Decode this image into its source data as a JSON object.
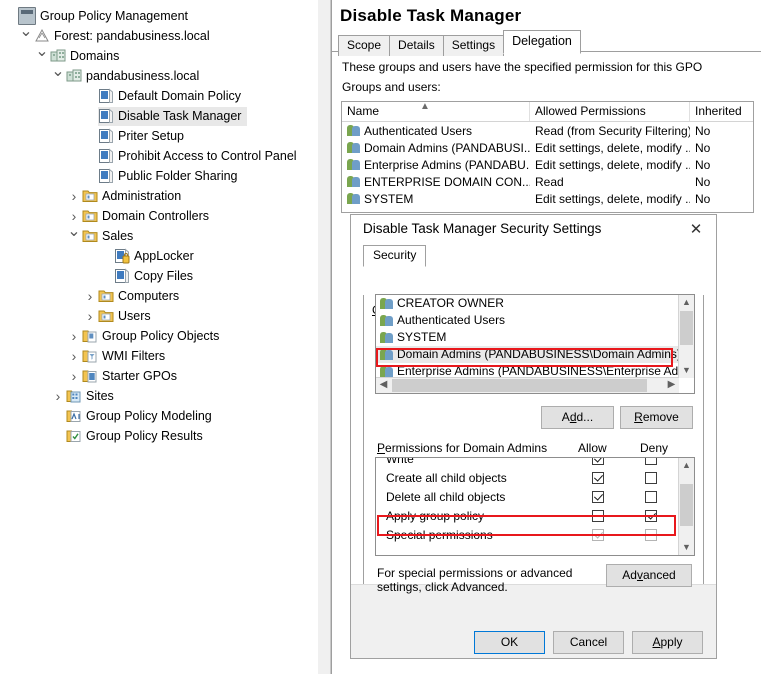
{
  "tree": {
    "items": [
      {
        "label": "Group Policy Management",
        "indent": 0,
        "chev": "",
        "icon": "console-icon",
        "selected": false
      },
      {
        "label": "Forest: pandabusiness.local",
        "indent": 1,
        "chev": "v",
        "icon": "forest-icon",
        "selected": false
      },
      {
        "label": "Domains",
        "indent": 2,
        "chev": "v",
        "icon": "domains-icon",
        "selected": false
      },
      {
        "label": "pandabusiness.local",
        "indent": 3,
        "chev": "v",
        "icon": "domain-icon",
        "selected": false
      },
      {
        "label": "Default Domain Policy",
        "indent": 5,
        "chev": "",
        "icon": "gpo-icon",
        "selected": false
      },
      {
        "label": "Disable Task Manager",
        "indent": 5,
        "chev": "",
        "icon": "gpo-icon",
        "selected": true
      },
      {
        "label": "Priter Setup",
        "indent": 5,
        "chev": "",
        "icon": "gpo-icon",
        "selected": false
      },
      {
        "label": "Prohibit Access to Control Panel",
        "indent": 5,
        "chev": "",
        "icon": "gpo-icon",
        "selected": false
      },
      {
        "label": "Public Folder Sharing",
        "indent": 5,
        "chev": "",
        "icon": "gpo-icon",
        "selected": false
      },
      {
        "label": "Administration",
        "indent": 4,
        "chev": ">",
        "icon": "ou-folder-icon",
        "selected": false
      },
      {
        "label": "Domain Controllers",
        "indent": 4,
        "chev": ">",
        "icon": "ou-folder-icon",
        "selected": false
      },
      {
        "label": "Sales",
        "indent": 4,
        "chev": "v",
        "icon": "ou-folder-icon",
        "selected": false
      },
      {
        "label": "AppLocker",
        "indent": 6,
        "chev": "",
        "icon": "gpo-locked-icon",
        "selected": false
      },
      {
        "label": "Copy Files",
        "indent": 6,
        "chev": "",
        "icon": "gpo-icon",
        "selected": false
      },
      {
        "label": "Computers",
        "indent": 5,
        "chev": ">",
        "icon": "ou-folder-icon",
        "selected": false
      },
      {
        "label": "Users",
        "indent": 5,
        "chev": ">",
        "icon": "ou-folder-icon",
        "selected": false
      },
      {
        "label": "Group Policy Objects",
        "indent": 4,
        "chev": ">",
        "icon": "gpo-container-icon",
        "selected": false
      },
      {
        "label": "WMI Filters",
        "indent": 4,
        "chev": ">",
        "icon": "wmi-filter-icon",
        "selected": false
      },
      {
        "label": "Starter GPOs",
        "indent": 4,
        "chev": ">",
        "icon": "starter-gpo-icon",
        "selected": false
      },
      {
        "label": "Sites",
        "indent": 3,
        "chev": ">",
        "icon": "sites-icon",
        "selected": false
      },
      {
        "label": "Group Policy Modeling",
        "indent": 3,
        "chev": "",
        "icon": "modeling-icon",
        "selected": false
      },
      {
        "label": "Group Policy Results",
        "indent": 3,
        "chev": "",
        "icon": "results-icon",
        "selected": false
      }
    ]
  },
  "right_pane": {
    "title": "Disable Task Manager",
    "tabs": [
      {
        "label": "Scope",
        "active": false
      },
      {
        "label": "Details",
        "active": false
      },
      {
        "label": "Settings",
        "active": false
      },
      {
        "label": "Delegation",
        "active": true
      }
    ],
    "description": "These groups and users have the specified permission for this GPO",
    "sub_label": "Groups and users:",
    "table": {
      "columns": [
        "Name",
        "Allowed Permissions",
        "Inherited"
      ],
      "sort_column": "Name",
      "rows": [
        {
          "name": "Authenticated Users",
          "permissions": "Read (from Security Filtering)",
          "inherited": "No"
        },
        {
          "name": "Domain Admins (PANDABUSI...",
          "permissions": "Edit settings, delete, modify ...",
          "inherited": "No"
        },
        {
          "name": "Enterprise Admins (PANDABU...",
          "permissions": "Edit settings, delete, modify ...",
          "inherited": "No"
        },
        {
          "name": "ENTERPRISE DOMAIN CON...",
          "permissions": "Read",
          "inherited": "No"
        },
        {
          "name": "SYSTEM",
          "permissions": "Edit settings, delete, modify ...",
          "inherited": "No"
        }
      ]
    }
  },
  "dialog": {
    "title": "Disable Task Manager Security Settings",
    "close_label": "✕",
    "tabs": [
      {
        "label": "Security",
        "active": true
      }
    ],
    "group_list_label": "Group or user names:",
    "groups": [
      {
        "label": "CREATOR OWNER",
        "selected": false
      },
      {
        "label": "Authenticated Users",
        "selected": false
      },
      {
        "label": "SYSTEM",
        "selected": false
      },
      {
        "label": "Domain Admins (PANDABUSINESS\\Domain Admins)",
        "selected": true
      },
      {
        "label": "Enterprise Admins (PANDABUSINESS\\Enterprise Admins)",
        "selected": false
      }
    ],
    "add_label": "Add...",
    "remove_label": "Remove",
    "permissions_label": "Permissions for Domain Admins",
    "allow_label": "Allow",
    "deny_label": "Deny",
    "permissions": [
      {
        "name": "Write",
        "allow": true,
        "deny": false,
        "dim": false
      },
      {
        "name": "Create all child objects",
        "allow": true,
        "deny": false,
        "dim": false
      },
      {
        "name": "Delete all child objects",
        "allow": true,
        "deny": false,
        "dim": false
      },
      {
        "name": "Apply group policy",
        "allow": false,
        "deny": true,
        "dim": false
      },
      {
        "name": "Special permissions",
        "allow": true,
        "deny": false,
        "dim": true
      }
    ],
    "advanced_text": "For special permissions or advanced settings, click Advanced.",
    "advanced_label": "Advanced",
    "ok_label": "OK",
    "cancel_label": "Cancel",
    "apply_label": "Apply"
  },
  "highlights": {
    "accent_color": "#e8181c",
    "selection_color": "#e9e9e9",
    "primary_border": "#0078d7"
  }
}
